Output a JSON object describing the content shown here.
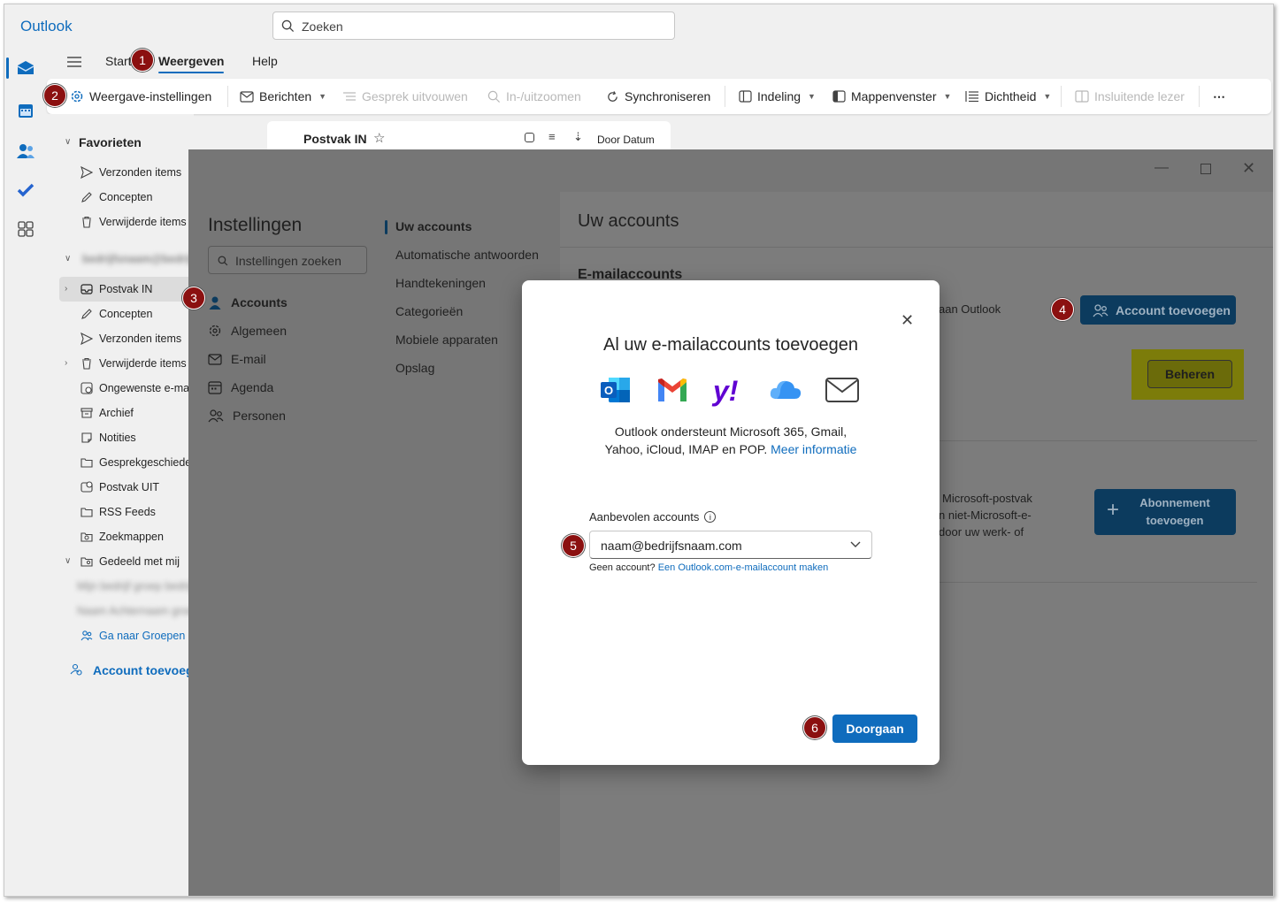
{
  "app": {
    "title": "Outlook"
  },
  "search": {
    "placeholder": "Zoeken"
  },
  "tabs": [
    {
      "label": "Start"
    },
    {
      "label": "Weergeven"
    },
    {
      "label": "Help"
    }
  ],
  "ribbon": {
    "view_settings": "Weergave-instellingen",
    "messages": "Berichten",
    "expand_conversation": "Gesprek uitvouwen",
    "zoom": "In-/uitzoomen",
    "sync": "Synchroniseren",
    "layout": "Indeling",
    "folder_pane": "Mappenvenster",
    "density": "Dichtheid",
    "immersive_reader": "Insluitende lezer",
    "more": "⋯"
  },
  "folders": {
    "favorites_header": "Favorieten",
    "favorites": [
      "Verzonden items",
      "Concepten",
      "Verwijderde items"
    ],
    "account_name": "bedrijfsnaam@bedrijfsnaam",
    "items": [
      "Postvak IN",
      "Concepten",
      "Verzonden items",
      "Verwijderde items",
      "Ongewenste e-mail",
      "Archief",
      "Notities",
      "Gesprekgeschiedenis",
      "Postvak UIT",
      "RSS Feeds",
      "Zoekmappen",
      "Gedeeld met mij"
    ],
    "shared_blurred": [
      "Mijn bedrijf groep bedrijf",
      "Naam Achternaam groep"
    ],
    "go_to_groups": "Ga naar Groepen",
    "add_account": "Account toevoegen"
  },
  "message_list": {
    "folder": "Postvak IN",
    "sort": "Door Datum"
  },
  "settings": {
    "title": "Instellingen",
    "search_placeholder": "Instellingen zoeken",
    "nav": [
      {
        "label": "Accounts"
      },
      {
        "label": "Algemeen"
      },
      {
        "label": "E-mail"
      },
      {
        "label": "Agenda"
      },
      {
        "label": "Personen"
      }
    ],
    "subnav": [
      "Uw accounts",
      "Automatische antwoorden",
      "Handtekeningen",
      "Categorieën",
      "Mobiele apparaten",
      "Opslag"
    ],
    "right": {
      "title": "Uw accounts",
      "section": "E-mailaccounts",
      "text_outlook": "aan Outlook",
      "add_account": "Account toevoegen",
      "manage": "Beheren",
      "text_subscription": [
        "Microsoft-postvak",
        "n niet-Microsoft-e-",
        "door uw werk- of"
      ],
      "add_subscription_1": "Abonnement",
      "add_subscription_2": "toevoegen"
    }
  },
  "modal": {
    "title": "Al uw e-mailaccounts toevoegen",
    "desc_line1": "Outlook ondersteunt Microsoft 365, Gmail,",
    "desc_line2": "Yahoo, iCloud, IMAP en POP.",
    "more_info": "Meer informatie",
    "recommended_label": "Aanbevolen accounts",
    "selected_account": "naam@bedrijfsnaam.com",
    "no_account": "Geen account?",
    "create_link": "Een Outlook.com-e-mailaccount maken",
    "continue": "Doorgaan"
  },
  "badges": [
    "1",
    "2",
    "3",
    "4",
    "5",
    "6"
  ],
  "colors": {
    "accent": "#0f6cbd",
    "badge": "#8b1010",
    "highlight": "#ffff00"
  }
}
